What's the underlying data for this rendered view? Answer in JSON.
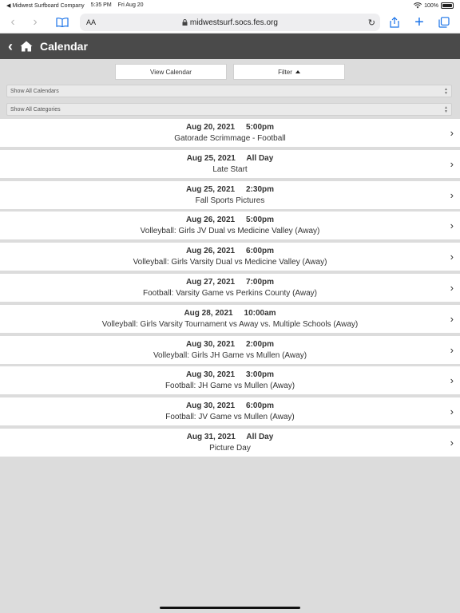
{
  "status": {
    "carrier": "◀ Midwest Surfboard Company",
    "time": "5:35 PM",
    "date": "Fri Aug 20",
    "battery": "100%",
    "battery_level": 1.0
  },
  "browser": {
    "aa": "AA",
    "url": "midwestsurf.socs.fes.org"
  },
  "header": {
    "title": "Calendar"
  },
  "buttons": {
    "view": "View Calendar",
    "filter": "Filter"
  },
  "selects": {
    "calendars": "Show All Calendars",
    "categories": "Show All Categories"
  },
  "events": [
    {
      "date": "Aug 20, 2021",
      "time": "5:00pm",
      "title": "Gatorade Scrimmage - Football"
    },
    {
      "date": "Aug 25, 2021",
      "time": "All Day",
      "title": "Late Start"
    },
    {
      "date": "Aug 25, 2021",
      "time": "2:30pm",
      "title": "Fall Sports Pictures"
    },
    {
      "date": "Aug 26, 2021",
      "time": "5:00pm",
      "title": "Volleyball: Girls JV Dual vs Medicine Valley (Away)"
    },
    {
      "date": "Aug 26, 2021",
      "time": "6:00pm",
      "title": "Volleyball: Girls Varsity Dual vs Medicine Valley (Away)"
    },
    {
      "date": "Aug 27, 2021",
      "time": "7:00pm",
      "title": "Football: Varsity Game vs Perkins County (Away)"
    },
    {
      "date": "Aug 28, 2021",
      "time": "10:00am",
      "title": "Volleyball: Girls Varsity Tournament vs Away vs. Multiple Schools (Away)"
    },
    {
      "date": "Aug 30, 2021",
      "time": "2:00pm",
      "title": "Volleyball: Girls JH Game vs Mullen (Away)"
    },
    {
      "date": "Aug 30, 2021",
      "time": "3:00pm",
      "title": "Football: JH Game vs Mullen (Away)"
    },
    {
      "date": "Aug 30, 2021",
      "time": "6:00pm",
      "title": "Football: JV Game vs Mullen (Away)"
    },
    {
      "date": "Aug 31, 2021",
      "time": "All Day",
      "title": "Picture Day"
    }
  ]
}
